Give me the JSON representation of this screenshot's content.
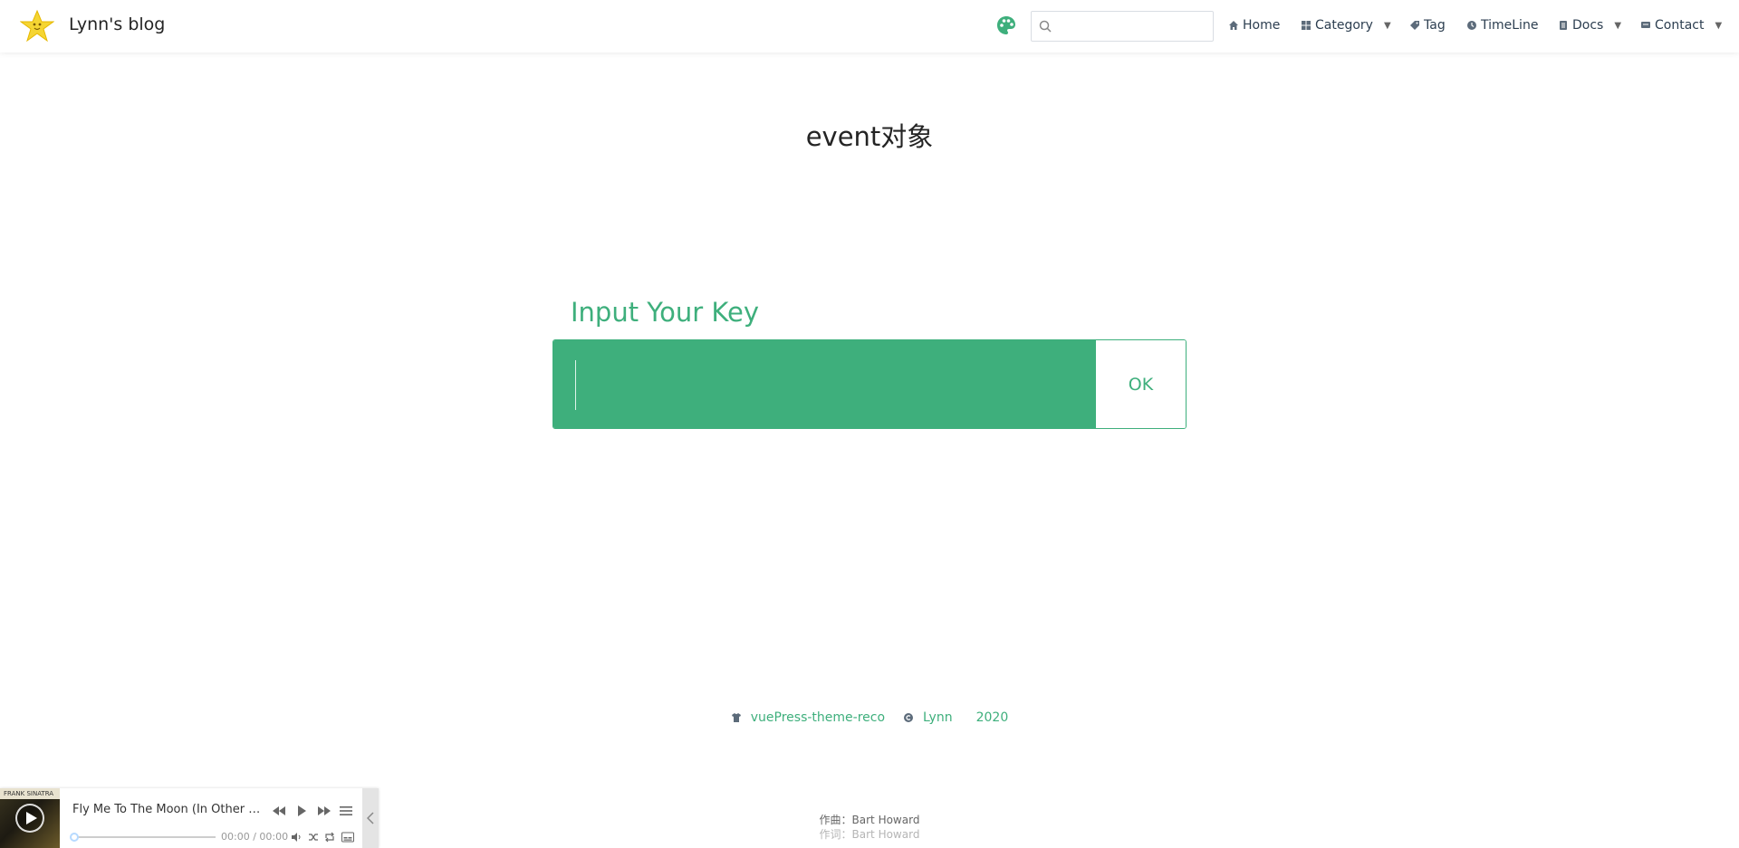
{
  "colors": {
    "accent": "#3eaf7c",
    "title_text": "#242424",
    "nav_text": "#2c3e50"
  },
  "navbar": {
    "site_title": "Lynn's blog",
    "logo_icon": "star-logo-icon",
    "theme_icon": "palette-icon",
    "search": {
      "value": "",
      "placeholder": ""
    },
    "items": [
      {
        "label": "Home",
        "icon": "home-icon",
        "dropdown": false
      },
      {
        "label": "Category",
        "icon": "grid-icon",
        "dropdown": true
      },
      {
        "label": "Tag",
        "icon": "tag-icon",
        "dropdown": false
      },
      {
        "label": "TimeLine",
        "icon": "clock-icon",
        "dropdown": false
      },
      {
        "label": "Docs",
        "icon": "document-icon",
        "dropdown": true
      },
      {
        "label": "Contact",
        "icon": "message-icon",
        "dropdown": true
      }
    ]
  },
  "main": {
    "title": "event对象",
    "password": {
      "label": "Input Your Key",
      "value": "",
      "button_label": "OK"
    }
  },
  "footer": {
    "theme_link": "vuePress-theme-reco",
    "author": "Lynn",
    "year": "2020",
    "theme_icon": "shirt-icon",
    "copyright_icon": "copyright-icon"
  },
  "player": {
    "song_title": "Fly Me To The Moon (In Other …",
    "time": "00:00 / 00:00",
    "progress": 0,
    "cover_text": "FRANK SINATRA",
    "lyrics": [
      "作曲：Bart Howard",
      "作词：Bart Howard"
    ]
  }
}
